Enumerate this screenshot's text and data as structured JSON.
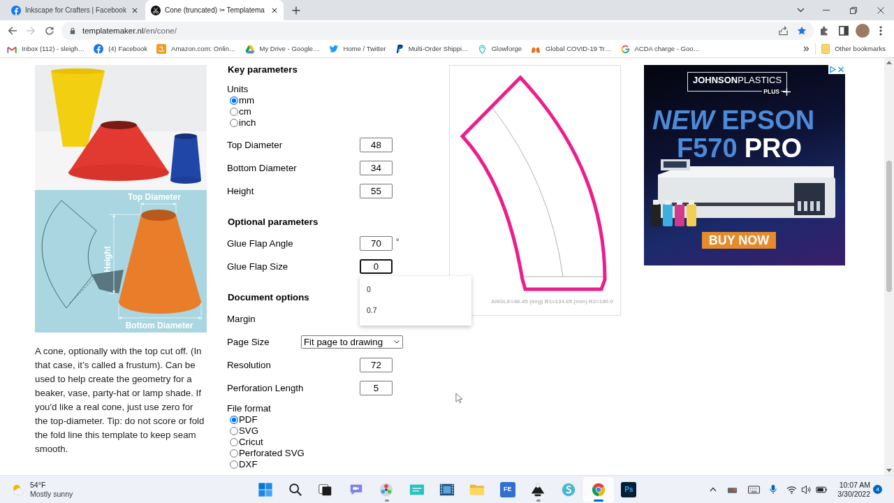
{
  "browser": {
    "tabs": [
      {
        "title": "Inkscape for Crafters | Facebook",
        "selected": false
      },
      {
        "title": "Cone (truncated) ✂ Templatema",
        "selected": true
      }
    ],
    "nav": {
      "back_enabled": true,
      "forward_enabled": false
    },
    "address": {
      "host": "templatemaker.nl",
      "path": "/en/cone/",
      "starred": true
    },
    "bookmarks": [
      {
        "label": "Inbox (112) - sleigh…"
      },
      {
        "label": "(4) Facebook"
      },
      {
        "label": "Amazon.com: Onlin…"
      },
      {
        "label": "My Drive - Google…"
      },
      {
        "label": "Home / Twitter"
      },
      {
        "label": "Multi-Order Shippi…"
      },
      {
        "label": "Glowforge"
      },
      {
        "label": "Global COVID-19 Tr…"
      },
      {
        "label": "ACDA charge - Goo…"
      }
    ],
    "other_bookmarks": "Other bookmarks"
  },
  "page": {
    "illustration": {
      "top_label": "Top Diameter",
      "side_label": "Height",
      "bottom_label": "Bottom Diameter"
    },
    "description": "A cone, optionally with the top cut off. (In that case, it’s called a frustum). Can be used to help create the geometry for a beaker, vase, party-hat or lamp shade. If you'd like a real cone, just use zero for the top-diameter. Tip: do not score or fold the fold line this template to keep seam smooth.",
    "form": {
      "sections": [
        {
          "heading": "Key parameters",
          "items": [
            {
              "kind": "radio_group",
              "label": "Units",
              "options": [
                {
                  "label": "mm",
                  "selected": true
                },
                {
                  "label": "cm",
                  "selected": false
                },
                {
                  "label": "inch",
                  "selected": false
                }
              ]
            },
            {
              "kind": "number",
              "label": "Top Diameter",
              "value": "48",
              "focused": false
            },
            {
              "kind": "number",
              "label": "Bottom Diameter",
              "value": "34",
              "focused": false
            },
            {
              "kind": "number",
              "label": "Height",
              "value": "55",
              "focused": false
            }
          ]
        },
        {
          "heading": "Optional parameters",
          "items": [
            {
              "kind": "number",
              "label": "Glue Flap Angle",
              "value": "70",
              "unit": "°",
              "focused": false
            },
            {
              "kind": "number",
              "label": "Glue Flap Size",
              "value": "0",
              "focused": true,
              "suggestions": [
                "0",
                "0.7"
              ]
            }
          ]
        },
        {
          "heading": "Document options",
          "items": [
            {
              "kind": "label",
              "label": "Margin"
            },
            {
              "kind": "select",
              "label": "Page Size",
              "value": "Fit page to drawing"
            },
            {
              "kind": "number",
              "label": "Resolution",
              "value": "72",
              "focused": false
            },
            {
              "kind": "number",
              "label": "Perforation Length",
              "value": "5",
              "focused": false
            },
            {
              "kind": "radio_group",
              "label": "File format",
              "options": [
                {
                  "label": "PDF",
                  "selected": true
                },
                {
                  "label": "SVG",
                  "selected": false
                },
                {
                  "label": "Cricut",
                  "selected": false
                },
                {
                  "label": "Perforated SVG",
                  "selected": false
                },
                {
                  "label": "DXF",
                  "selected": false
                }
              ]
            }
          ]
        }
      ]
    },
    "preview": {
      "caption": "ANGLE=46.45 (deg) R1=134.65 (mm) R2=180.0"
    },
    "ad": {
      "brand": "**JOHNSON**PLASTICS",
      "brand_tag": "PLUS",
      "headline": "*NEW* EPSON",
      "model": "F570",
      "model_suffix": "PRO",
      "button": "BUY NOW"
    }
  },
  "taskbar": {
    "weather": {
      "temperature": "54°F",
      "condition": "Mostly sunny"
    },
    "apps": [
      {
        "running": false,
        "selected": false
      },
      {
        "running": false,
        "selected": false
      },
      {
        "running": false,
        "selected": false
      },
      {
        "running": false,
        "selected": false
      },
      {
        "running": true,
        "selected": false
      },
      {
        "running": false,
        "selected": false
      },
      {
        "running": false,
        "selected": false
      },
      {
        "running": false,
        "selected": false
      },
      {
        "running": false,
        "selected": false,
        "label": "FE"
      },
      {
        "running": true,
        "selected": false
      },
      {
        "running": false,
        "selected": false
      },
      {
        "running": true,
        "selected": true
      },
      {
        "running": false,
        "selected": false,
        "label": "Ps"
      }
    ],
    "clock": {
      "time": "10:07 AM",
      "date": "3/30/2022"
    },
    "notifications": "4"
  }
}
